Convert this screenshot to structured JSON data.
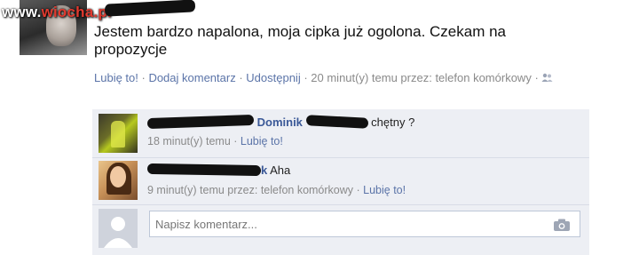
{
  "watermark": {
    "prefix": "www.",
    "brand": "wiocha",
    "suffix": ".pl"
  },
  "post": {
    "text": "Jestem bardzo napalona, moja cipka już ogolona. Czekam na propozycje",
    "actions": [
      "Lubię to!",
      "Dodaj komentarz",
      "Udostępnij"
    ],
    "time": "20 minut(y) temu przez: telefon komórkowy",
    "separator": " · ",
    "trailing_dot": " ·"
  },
  "comments": [
    {
      "author_visible": "Dominik",
      "text": "chętny ?",
      "time": "18 minut(y) temu",
      "like_label": "Lubię to!"
    },
    {
      "author_visible": "k",
      "text": "Aha",
      "time": "9 minut(y) temu przez: telefon komórkowy",
      "like_label": "Lubię to!"
    }
  ],
  "comment_input": {
    "placeholder": "Napisz komentarz..."
  },
  "colors": {
    "link": "#5b74a8",
    "author": "#3b5998",
    "comment_bg": "#edeff4",
    "scribble": "#111111"
  }
}
